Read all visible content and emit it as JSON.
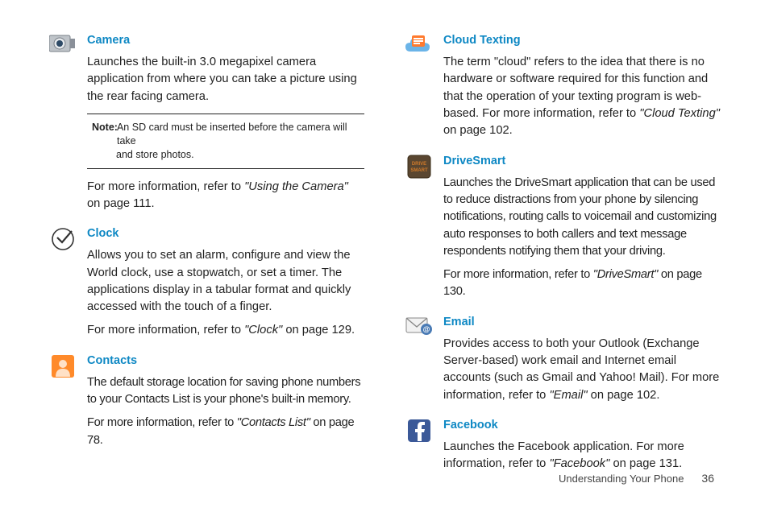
{
  "left": {
    "camera": {
      "title": "Camera",
      "para1": "Launches the built-in 3.0 megapixel camera application from where you can take a picture using the rear facing camera.",
      "note_label": "Note:",
      "note_text_a": "An SD card must be inserted before the camera will take",
      "note_text_b": "and store photos.",
      "ref_a": "For more information, refer to ",
      "ref_i": "\"Using the Camera\"",
      "ref_b": "  on page 111."
    },
    "clock": {
      "title": "Clock",
      "para1": "Allows you to set an alarm, configure and view the World clock, use a stopwatch, or set a timer. The applications display in a tabular format and quickly accessed with the touch of a finger.",
      "ref_a": "For more information, refer to ",
      "ref_i": "\"Clock\"",
      "ref_b": "  on page 129."
    },
    "contacts": {
      "title": "Contacts",
      "para1": "The default storage location for saving phone numbers to your Contacts List is your phone's built-in memory.",
      "ref_a": "For more information, refer to ",
      "ref_i": "\"Contacts List\"",
      "ref_b": "  on page 78."
    }
  },
  "right": {
    "cloud": {
      "title": "Cloud Texting",
      "para_a": "The term \"cloud\" refers to the idea that there is no hardware or software required for this function and that the operation of your texting program is web-based. For more information, refer to ",
      "para_i": "\"Cloud Texting\"",
      "para_b": "  on page 102."
    },
    "drivesmart": {
      "title": "DriveSmart",
      "para1": "Launches the DriveSmart application that can be used to reduce distractions from your phone by silencing notifications, routing calls to voicemail and customizing auto responses to both callers and text message respondents notifying them that your driving.",
      "ref_a": "For more information, refer to ",
      "ref_i": "\"DriveSmart\"",
      "ref_b": "  on page 130."
    },
    "email": {
      "title": "Email",
      "para_a": "Provides access to both your Outlook (Exchange Server-based) work email and Internet email accounts (such as Gmail and Yahoo! Mail). For more information, refer to ",
      "para_i": "\"Email\"",
      "para_b": "  on page 102."
    },
    "facebook": {
      "title": "Facebook",
      "para_a": "Launches the Facebook application. For more information, refer to ",
      "para_i": "\"Facebook\"",
      "para_b": "  on page 131."
    }
  },
  "footer": {
    "section": "Understanding Your Phone",
    "page": "36"
  }
}
